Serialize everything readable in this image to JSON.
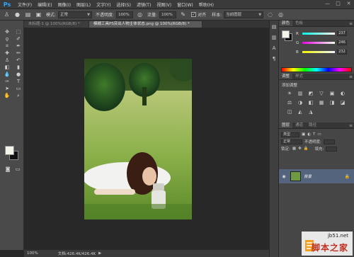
{
  "app": {
    "logo": "Ps",
    "menu": [
      "文件(F)",
      "编辑(E)",
      "图像(I)",
      "图层(L)",
      "文字(Y)",
      "选择(S)",
      "滤镜(T)",
      "视图(V)",
      "窗口(W)",
      "帮助(H)"
    ],
    "window_controls": [
      "—",
      "□",
      "✕"
    ]
  },
  "options_bar": {
    "mode_label": "模式:",
    "mode_value": "正常",
    "opacity_label": "不透明度:",
    "opacity_value": "100%",
    "flow_label": "流量:",
    "flow_value": "100%",
    "aligned_label": "对齐",
    "sample_label": "样本:",
    "sample_value": "当前图层"
  },
  "tabs": [
    {
      "label": "未标题-1 @ 100%(RGB/8) *",
      "active": false
    },
    {
      "label": "模糊工具PS突出人物主体状态.png @ 100%(RGB/8) *",
      "active": true
    }
  ],
  "status": {
    "zoom": "100%",
    "doc": "文档:426.4K/426.4K"
  },
  "color_panel": {
    "tabs": [
      "颜色",
      "色板"
    ],
    "channels": [
      {
        "name": "R",
        "value": "237",
        "gradient": [
          "#00f4ea",
          "#fff4ea"
        ]
      },
      {
        "name": "G",
        "value": "246",
        "gradient": [
          "#ed00ea",
          "#edffea"
        ]
      },
      {
        "name": "B",
        "value": "232",
        "gradient": [
          "#edf400",
          "#edf4ff"
        ]
      }
    ],
    "foreground": "#f4f4ea",
    "background": "#111111"
  },
  "adjustments_panel": {
    "tabs": [
      "调整",
      "样式"
    ],
    "title": "添加调整",
    "icons": [
      "☀",
      "▥",
      "◩",
      "▽",
      "▣",
      "◐",
      "⚖",
      "◑",
      "◧",
      "▦",
      "◨",
      "◪",
      "◫",
      "◭",
      "◮"
    ]
  },
  "layers_panel": {
    "tabs": [
      "图层",
      "通道",
      "路径"
    ],
    "kind_label": "类型",
    "blend_value": "正常",
    "opacity_label": "不透明度:",
    "lock_label": "锁定:",
    "fill_label": "填充:",
    "layer_name": "背景"
  },
  "watermark": {
    "url": "jb51.net",
    "name": "脚本之家"
  }
}
